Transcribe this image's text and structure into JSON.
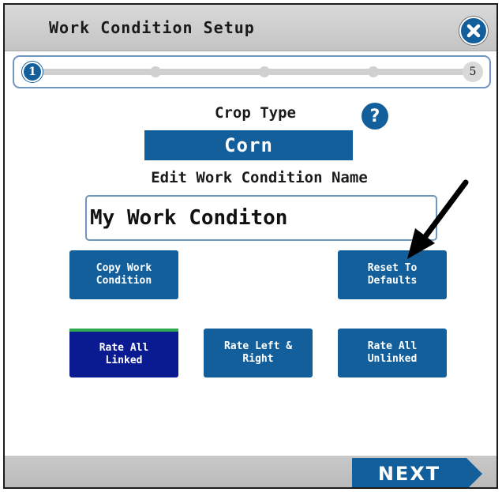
{
  "header": {
    "title": "Work Condition Setup",
    "close_icon": "close-x-icon"
  },
  "progress": {
    "current_step": "1",
    "total_steps": "5",
    "step_fraction": 0.2
  },
  "crop": {
    "label": "Crop Type",
    "help_icon": "?",
    "value": "Corn"
  },
  "work_condition": {
    "label": "Edit Work Condition Name",
    "name_value": "My Work Conditon"
  },
  "actions": {
    "copy_label": "Copy Work\nCondition",
    "reset_label": "Reset To\nDefaults"
  },
  "rate_modes": {
    "linked_label": "Rate All\nLinked",
    "left_right_label": "Rate Left &\nRight",
    "unlinked_label": "Rate All\nUnlinked",
    "selected": "Rate All Linked"
  },
  "footer": {
    "next_label": "NEXT"
  },
  "colors": {
    "accent": "#135f9c",
    "selected": "#0a1a91",
    "selected_indicator": "#2fa84f"
  }
}
